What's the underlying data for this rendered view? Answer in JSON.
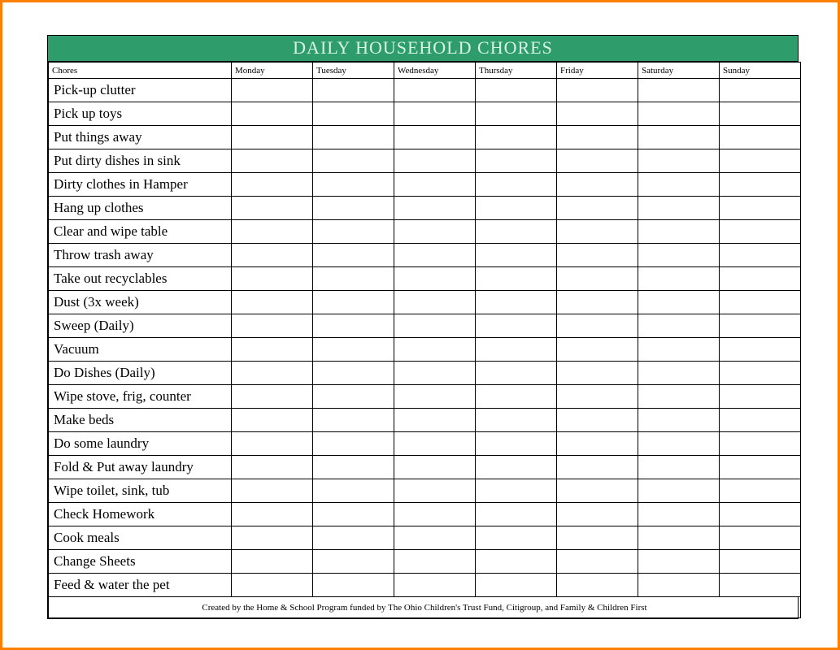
{
  "title": "DAILY HOUSEHOLD CHORES",
  "columns": [
    "Chores",
    "Monday",
    "Tuesday",
    "Wednesday",
    "Thursday",
    "Friday",
    "Saturday",
    "Sunday"
  ],
  "chores": [
    "Pick-up clutter",
    "Pick up toys",
    "Put things away",
    "Put dirty dishes in sink",
    "Dirty clothes in Hamper",
    "Hang up clothes",
    "Clear and wipe table",
    "Throw trash away",
    "Take out recyclables",
    "Dust (3x week)",
    "Sweep (Daily)",
    "Vacuum",
    "Do Dishes (Daily)",
    "Wipe stove, frig, counter",
    "Make beds",
    "Do some laundry",
    "Fold & Put away laundry",
    "Wipe toilet, sink, tub",
    "Check Homework",
    "Cook meals",
    "Change Sheets",
    "Feed & water the pet"
  ],
  "footer": "Created by the Home & School Program funded by The Ohio Children's Trust Fund, Citigroup, and Family & Children First",
  "colors": {
    "frame_border": "#ff7f00",
    "header_bg": "#2f9c6b",
    "header_text": "#d7f3e6"
  }
}
